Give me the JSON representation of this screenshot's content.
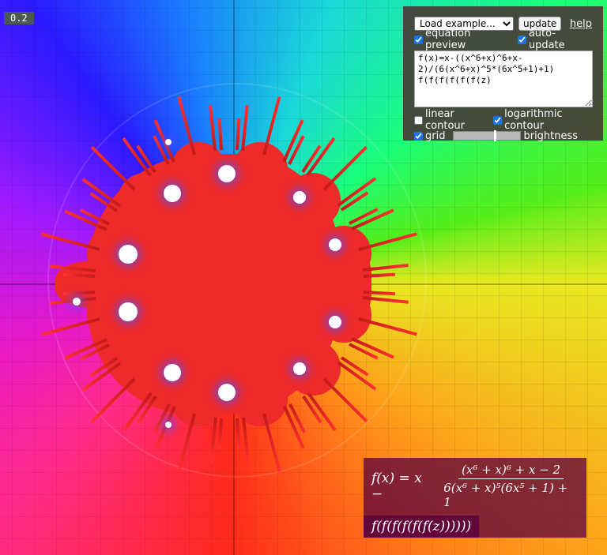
{
  "scale_label": "0.2",
  "toolbar": {
    "example_select_value": "Load example...",
    "update_label": "update",
    "help_label": "help"
  },
  "options": {
    "equation_preview": {
      "label": "equation preview",
      "checked": true
    },
    "auto_update": {
      "label": "auto-update",
      "checked": true
    },
    "linear_contour": {
      "label": "linear contour",
      "checked": false
    },
    "logarithmic_contour": {
      "label": "logarithmic contour",
      "checked": true
    },
    "grid": {
      "label": "grid",
      "checked": true
    },
    "brightness": {
      "label": "brightness",
      "value_fraction": 0.62
    }
  },
  "editor": {
    "value": "f(x)=x-((x^6+x)^6+x-2)/(6(x^6+x)^5*(6x^5+1)+1)\nf(f(f(f(f(f(z)"
  },
  "formula": {
    "lhs": "f(x) = x −",
    "numerator": "(x⁶ + x)⁶ + x − 2",
    "denominator": "6(x⁶ + x)⁵(6x⁵ + 1) + 1",
    "line2": "f(f(f(f(f(f(z))))))"
  },
  "colors": {
    "panel_bg": "#463c37",
    "fractal_red": "#ee2a2a",
    "formula_bg": "#5a003c"
  }
}
